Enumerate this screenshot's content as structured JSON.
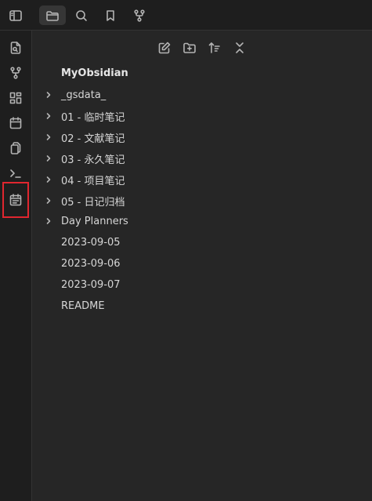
{
  "topbar": {
    "buttons": [
      {
        "icon": "sidebar-toggle-icon"
      },
      {
        "icon": "folder-icon",
        "active": true
      },
      {
        "icon": "search-icon"
      },
      {
        "icon": "bookmark-icon"
      },
      {
        "icon": "git-fork-icon"
      }
    ]
  },
  "ribbon": {
    "buttons": [
      {
        "icon": "file-search-icon"
      },
      {
        "icon": "graph-icon"
      },
      {
        "icon": "dashboard-icon"
      },
      {
        "icon": "calendar-icon"
      },
      {
        "icon": "copy-icon"
      },
      {
        "icon": "terminal-icon"
      },
      {
        "icon": "day-planner-icon",
        "highlighted": true
      }
    ]
  },
  "explorer": {
    "actions": [
      "new-note-icon",
      "new-folder-icon",
      "sort-icon",
      "collapse-all-icon"
    ],
    "vault_name": "MyObsidian",
    "items": [
      {
        "label": "_gsdata_",
        "type": "folder"
      },
      {
        "label": "01 - 临时笔记",
        "type": "folder"
      },
      {
        "label": "02 - 文献笔记",
        "type": "folder"
      },
      {
        "label": "03 - 永久笔记",
        "type": "folder"
      },
      {
        "label": "04 - 项目笔记",
        "type": "folder"
      },
      {
        "label": "05 - 日记归档",
        "type": "folder"
      },
      {
        "label": "Day Planners",
        "type": "folder"
      },
      {
        "label": "2023-09-05",
        "type": "file"
      },
      {
        "label": "2023-09-06",
        "type": "file"
      },
      {
        "label": "2023-09-07",
        "type": "file"
      },
      {
        "label": "README",
        "type": "file"
      }
    ]
  },
  "colors": {
    "highlight": "#e0262f",
    "background": "#262626",
    "sidebar": "#1e1e1e"
  }
}
